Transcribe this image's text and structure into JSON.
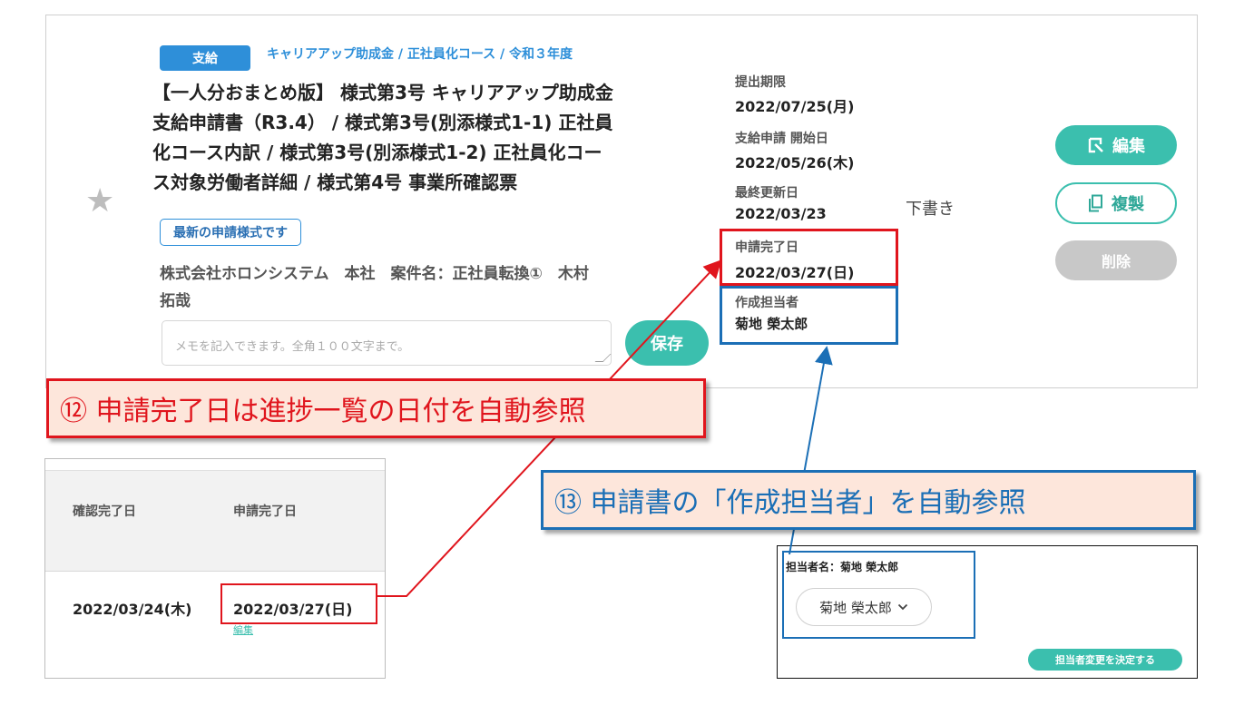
{
  "card": {
    "type_badge": "支給",
    "breadcrumb": "キャリアアップ助成金 / 正社員化コース / 令和３年度",
    "title": "【一人分おまとめ版】 様式第3号 キャリアアップ助成金\n支給申請書（R3.4） / 様式第3号(別添様式1-1) 正社員\n化コース内訳 / 様式第3号(別添様式1-2) 正社員化コー\nス対象労働者詳細 / 様式第4号 事業所確認票",
    "star_icon": "star-icon",
    "latest_badge": "最新の申請様式です",
    "company_line": "株式会社ホロンシステム　本社　案件名：正社員転換①　木村\n拓哉",
    "memo_placeholder": "メモを記入できます。全角１００文字まで。",
    "save_label": "保存",
    "deadline_label": "提出期限",
    "deadline_value": "2022/07/25(月)",
    "start_label": "支給申請 開始日",
    "start_value": "2022/05/26(木)",
    "updated_label": "最終更新日",
    "updated_value": "2022/03/23",
    "completed_label": "申請完了日",
    "completed_value": "2022/03/27(日)",
    "creator_label": "作成担当者",
    "creator_value": "菊地 榮太郎",
    "status": "下書き",
    "edit_label": "編集",
    "copy_label": "複製",
    "delete_label": "削除"
  },
  "callouts": {
    "red": "⑫ 申請完了日は進捗一覧の日付を自動参照",
    "blue": "⑬ 申請書の「作成担当者」を自動参照"
  },
  "progress_table": {
    "headers": [
      "確認完了日",
      "申請完了日"
    ],
    "row": [
      "2022/03/24(木)",
      "2022/03/27(日)"
    ],
    "edit_link": "編集"
  },
  "assignee_panel": {
    "label": "担当者名：菊地 榮太郎",
    "select_value": "菊地 榮太郎",
    "confirm_label": "担当者変更を決定する"
  },
  "colors": {
    "accent_teal": "#3bbfae",
    "badge_blue": "#2e8fd9",
    "highlight_red": "#e0151d",
    "highlight_blue": "#1b6fb6",
    "callout_fill": "#fde6db"
  }
}
